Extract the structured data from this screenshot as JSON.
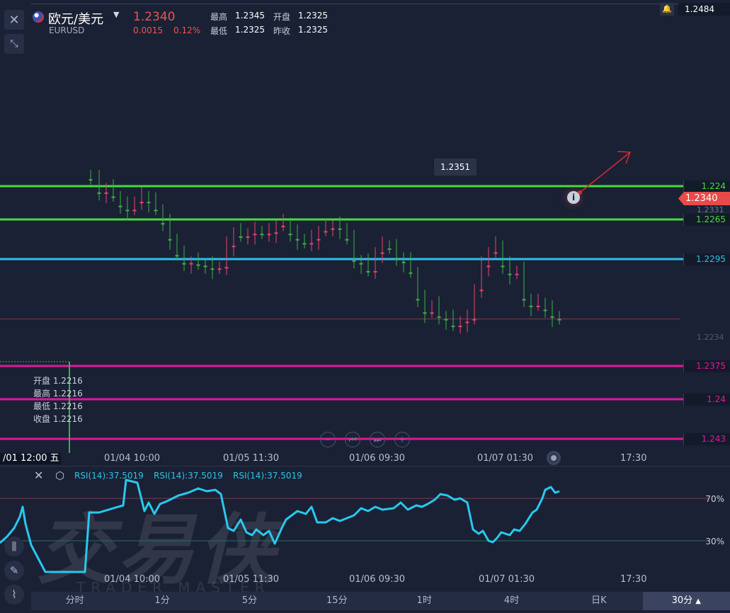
{
  "header": {
    "pair_name": "欧元/美元",
    "pair_code": "EURUSD",
    "last_price": "1.2340",
    "change": "0.0015",
    "change_pct": "0.12%",
    "high_label": "最高",
    "high_value": "1.2345",
    "open_label": "开盘",
    "open_value": "1.2325",
    "low_label": "最低",
    "low_value": "1.2325",
    "prev_close_label": "昨收",
    "prev_close_value": "1.2325"
  },
  "price_axis": {
    "top_value": "1.2484",
    "current_tag": "1.2340",
    "sub_tag": "1.2331",
    "bottom_faint": "1.2234"
  },
  "levels": [
    {
      "value": "1.243",
      "color": "#e0189b"
    },
    {
      "value": "1.24",
      "color": "#e0189b"
    },
    {
      "value": "1.2375",
      "color": "#e0189b"
    },
    {
      "value": "1.2295",
      "color": "#29c3e6"
    },
    {
      "value": "1.2265",
      "color": "#46dc3c"
    },
    {
      "value": "1.224",
      "color": "#46dc3c"
    }
  ],
  "peak_label": "1.2351",
  "ohlc_popup": {
    "open": "开盘 1.2216",
    "high": "最高 1.2216",
    "low": "最低 1.2216",
    "close": "收盘 1.2216"
  },
  "cursor_time": "/01 12:00 五",
  "main_x_labels": [
    "01/04 10:00",
    "01/05 11:30",
    "01/06 09:30",
    "01/07 01:30",
    "17:30"
  ],
  "rsi": {
    "labels": [
      "RSI(14):37.5019",
      "RSI(14):37.5019",
      "RSI(14):37.5019"
    ],
    "level_70": "70%",
    "level_30": "30%",
    "x_labels": [
      "01/04 10:00",
      "01/05 11:30",
      "01/06 09:30",
      "01/07 01:30",
      "17:30"
    ]
  },
  "watermark": {
    "main": "交易侠",
    "sub": "TRADER MASTER"
  },
  "periods": [
    "分时",
    "1分",
    "5分",
    "15分",
    "1时",
    "4时",
    "日K",
    "30分"
  ],
  "active_period": "30分",
  "icons": [
    "close-icon",
    "collapse-icon",
    "flag-icon",
    "dropdown-icon",
    "bell-icon",
    "info-icon",
    "zoom-out-icon",
    "skip-back-icon",
    "skip-forward-icon",
    "zoom-in-icon",
    "record-icon",
    "settings-icon",
    "candle-icon",
    "pen-icon",
    "indicator-icon"
  ],
  "colors": {
    "up": "#3fae49",
    "down": "#e8426b",
    "magenta": "#e0189b",
    "cyan": "#29c3e6",
    "green": "#46dc3c",
    "accent_red": "#ef5350"
  }
}
